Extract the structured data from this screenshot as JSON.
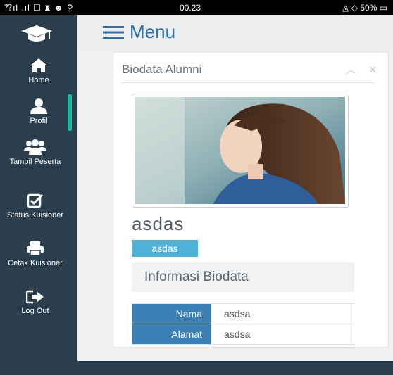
{
  "status_bar": {
    "left": "⁇ıl .ıl ☐ ⧗ ☻ ⚲",
    "time": "00.23",
    "right": "◬ ◇ 50% ▭"
  },
  "sidebar": {
    "items": [
      {
        "label": "Home",
        "icon": "home-icon"
      },
      {
        "label": "Profil",
        "icon": "user-icon"
      },
      {
        "label": "Tampil Peserta",
        "icon": "users-icon"
      },
      {
        "label": "Status Kuisioner",
        "icon": "check-square-icon"
      },
      {
        "label": "Cetak Kuisioner",
        "icon": "print-icon"
      },
      {
        "label": "Log Out",
        "icon": "sign-out-icon"
      }
    ],
    "active_index": 1,
    "active_color": "#1abc9c"
  },
  "header": {
    "menu_label": "Menu"
  },
  "panel": {
    "title": "Biodata Alumni",
    "collapse_icon": "chevron-up-icon",
    "close_icon": "close-icon",
    "profile_name": "asdas",
    "badge": "asdas",
    "info_heading": "Informasi Biodata",
    "rows": [
      {
        "label": "Nama",
        "value": "asdsa"
      },
      {
        "label": "Alamat",
        "value": "asdsa"
      }
    ]
  },
  "colors": {
    "sidebar": "#2b3e4d",
    "accent": "#2d6fa6",
    "badge": "#4fb3d9",
    "table_label": "#3a7fb5"
  }
}
